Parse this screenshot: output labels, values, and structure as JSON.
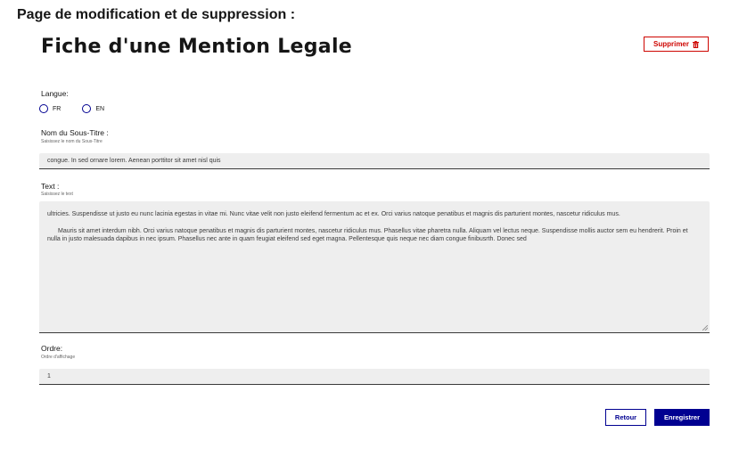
{
  "page": {
    "heading": "Page de modification et de suppression :",
    "card_title": "Fiche d'une Mention Legale"
  },
  "actions": {
    "delete_label": "Supprimer",
    "back_label": "Retour",
    "save_label": "Enregistrer"
  },
  "form": {
    "langue": {
      "label": "Langue:",
      "options": [
        "FR",
        "EN"
      ]
    },
    "subtitle": {
      "label": "Nom du Sous-Titre :",
      "hint": "Saisissez le nom du Sous-Titre",
      "value": "congue. In sed ornare lorem. Aenean porttitor sit amet nisl quis"
    },
    "text": {
      "label": "Text :",
      "hint": "Saisissez le text",
      "paragraph_1": "ultricies. Suspendisse ut justo eu nunc lacinia egestas in vitae mi. Nunc vitae velit non justo eleifend fermentum ac et ex. Orci varius natoque penatibus et magnis dis parturient montes, nascetur ridiculus mus.",
      "paragraph_2": "Mauris sit amet interdum nibh. Orci varius natoque penatibus et magnis dis parturient montes, nascetur ridiculus mus. Phasellus vitae pharetra nulla. Aliquam vel lectus neque. Suspendisse mollis auctor sem eu hendrerit. Proin et nulla in justo malesuada dapibus in nec ipsum. Phasellus nec ante in quam feugiat eleifend sed eget magna. Pellentesque quis neque nec diam congue finibusrth. Donec sed"
    },
    "ordre": {
      "label": "Ordre:",
      "hint": "Ordre d'affichage",
      "value": "1"
    }
  },
  "colors": {
    "primary": "#000091",
    "danger": "#ce0500",
    "field_bg": "#eeeeee"
  },
  "icons": {
    "delete": "trash-icon"
  }
}
